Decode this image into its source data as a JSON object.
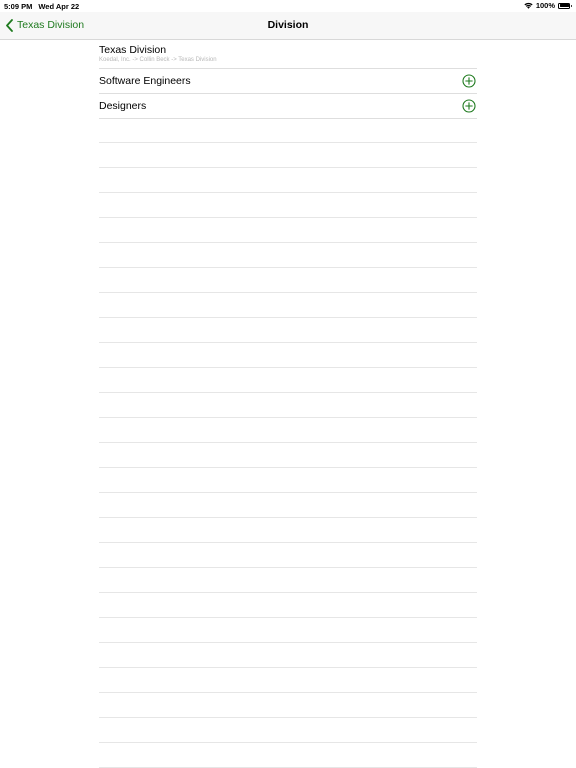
{
  "status_bar": {
    "time": "5:09 PM",
    "date": "Wed Apr 22",
    "battery": "100%",
    "wifi_icon": "wifi-icon",
    "battery_icon": "battery-icon",
    "battery_level": 1.0
  },
  "nav": {
    "back_label": "Texas Division",
    "back_icon": "chevron-left-icon",
    "title": "Division",
    "accent_color": "#1e7a1e"
  },
  "header": {
    "title": "Texas Division",
    "path": "Koedal, Inc. -> Collin Beck -> Texas Division"
  },
  "rows": [
    {
      "label": "Software Engineers",
      "icon": "add-circle-icon"
    },
    {
      "label": "Designers",
      "icon": "add-circle-icon"
    }
  ]
}
